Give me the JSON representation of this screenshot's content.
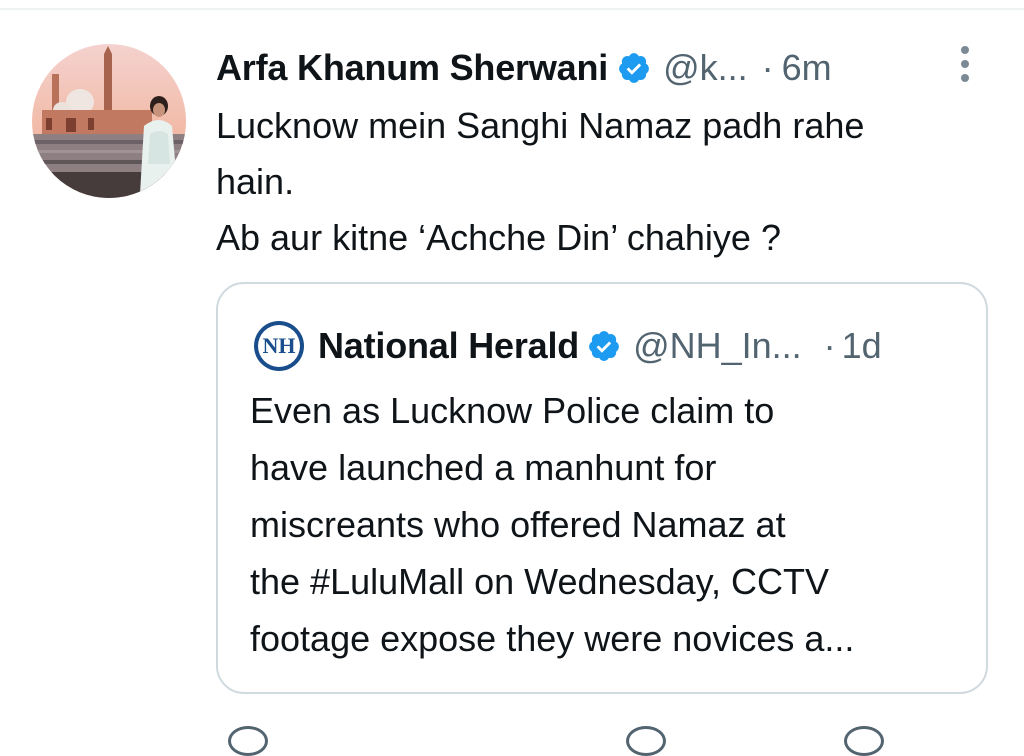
{
  "tweet": {
    "author_name": "Arfa Khanum Sherwani",
    "handle": "@k...",
    "separator": "·",
    "time": "6m",
    "text_lines": [
      "Lucknow mein Sanghi Namaz padh rahe",
      "hain.",
      "Ab aur kitne ‘Achche Din’ chahiye ?"
    ],
    "avatar_icon": "profile-photo-mosque",
    "verified_icon": "verified-badge-icon",
    "more_icon": "more-options-icon"
  },
  "quote": {
    "logo_icon": "national-herald-logo",
    "logo_text": "NH",
    "author_name": "National Herald",
    "handle": "@NH_In...",
    "separator": "·",
    "time": "1d",
    "text_lines": [
      "Even as Lucknow Police claim to",
      "have launched a manhunt for",
      "miscreants who offered Namaz at",
      "the #LuluMall on Wednesday, CCTV",
      "footage expose they were novices a..."
    ]
  },
  "colors": {
    "text": "#0f1419",
    "secondary": "#536471",
    "verified": "#1d9bf0",
    "border": "#cfd9de",
    "nh_blue": "#1a4d8c"
  }
}
